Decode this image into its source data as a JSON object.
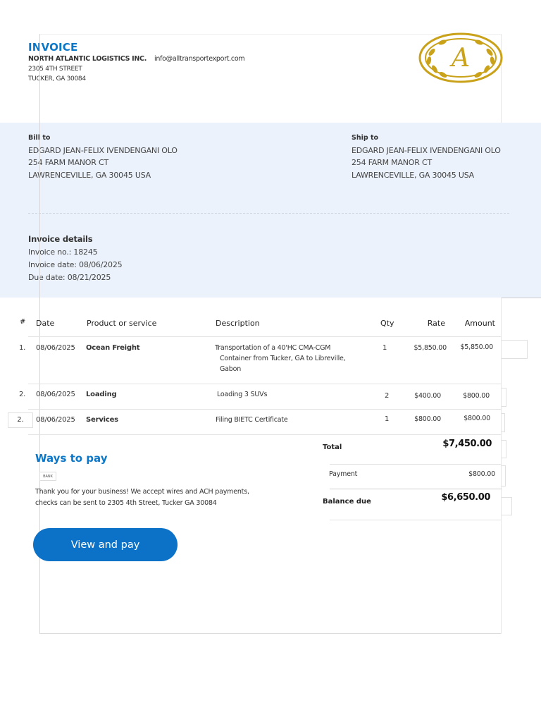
{
  "header": {
    "title": "INVOICE",
    "company": "NORTH ATLANTIC LOGISTICS INC.",
    "email": "info@alltransportexport.com",
    "address_line1": "2305 4TH STREET",
    "address_line2": "TUCKER, GA 30084",
    "logo_letter": "A"
  },
  "bill_to": {
    "label": "Bill to",
    "name": "EDGARD JEAN-FELIX IVENDENGANI OLO",
    "street": "254 FARM MANOR CT",
    "city": "LAWRENCEVILLE, GA 30045 USA"
  },
  "ship_to": {
    "label": "Ship to",
    "name": "EDGARD JEAN-FELIX IVENDENGANI OLO",
    "street": "254 FARM MANOR CT",
    "city": "LAWRENCEVILLE, GA 30045 USA"
  },
  "invoice_details": {
    "label": "Invoice details",
    "number": "Invoice no.: 18245",
    "date": "Invoice date: 08/06/2025",
    "due": "Due date: 08/21/2025"
  },
  "table": {
    "headers": [
      "#",
      "Date",
      "Product or service",
      "Description",
      "Qty",
      "Rate",
      "Amount"
    ],
    "rows": [
      {
        "num": "1.",
        "date": "08/06/2025",
        "product": "Ocean Freight",
        "desc1": "Transportation of a 40'HC CMA-CGM",
        "desc2": "Container from Tucker, GA to Libreville,",
        "desc3": "Gabon",
        "qty": "1",
        "rate": "$5,850.00",
        "amount": "$5,850.00"
      },
      {
        "num": "2.",
        "date": "08/06/2025",
        "product": "Loading",
        "desc1": "Loading 3 SUVs",
        "qty": "2",
        "rate": "$400.00",
        "amount": "$800.00"
      },
      {
        "num": "2.",
        "date": "08/06/2025",
        "product": "Services",
        "desc1": "Filing BIETC Certificate",
        "qty": "1",
        "rate": "$800.00",
        "amount": "$800.00"
      }
    ]
  },
  "totals": {
    "total_label": "Total",
    "total_value": "$7,450.00",
    "payment_label": "Payment",
    "payment_value": "$800.00",
    "balance_label": "Balance due",
    "balance_value": "$6,650.00"
  },
  "payment": {
    "heading": "Ways to pay",
    "bank_label": "BANK",
    "thanks_line1": "Thank you for your business! We accept wires and ACH payments,",
    "thanks_line2": "checks can be sent to 2305 4th Street, Tucker GA 30084",
    "button_label": "View and pay"
  },
  "colors": {
    "accent": "#0a77c9",
    "button": "#0b72c8",
    "logo_gold": "#c9a21a",
    "panel": "#ebf2fb"
  }
}
